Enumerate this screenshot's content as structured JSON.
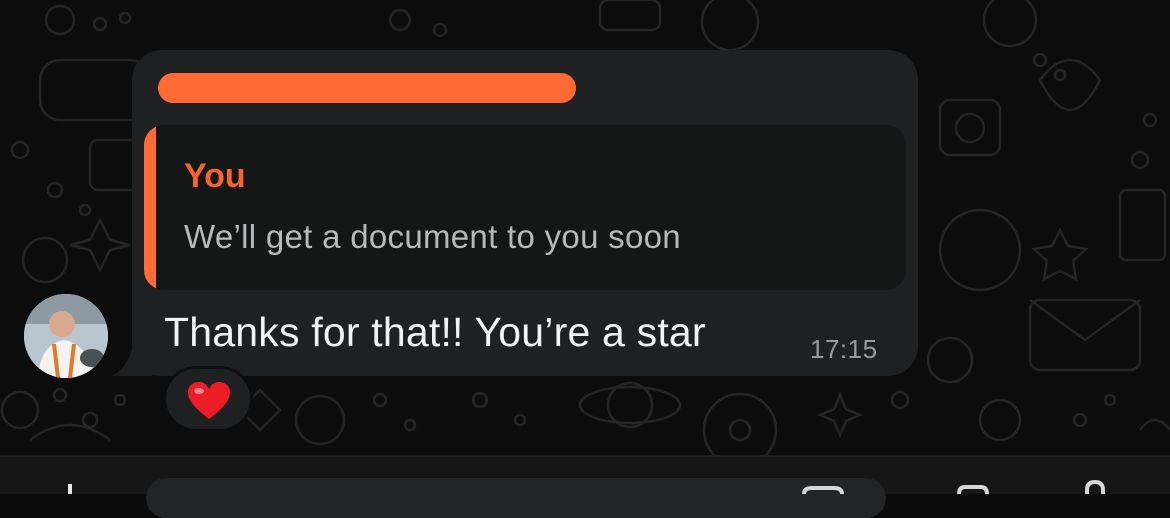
{
  "message": {
    "reply": {
      "author": "You",
      "text": "We’ll get a document to you soon"
    },
    "text": "Thanks for that!! You’re a star",
    "time": "17:15",
    "reaction": "heart-emoji"
  },
  "icons": {
    "avatar": "profile-photo",
    "attach": "plus-icon",
    "sticker": "sticker-icon",
    "camera": "camera-icon",
    "mic": "mic-icon"
  },
  "colors": {
    "accent": "#f4642f",
    "bubble": "#1f2021",
    "quote": "#151616",
    "background": "#0c0c0c"
  }
}
